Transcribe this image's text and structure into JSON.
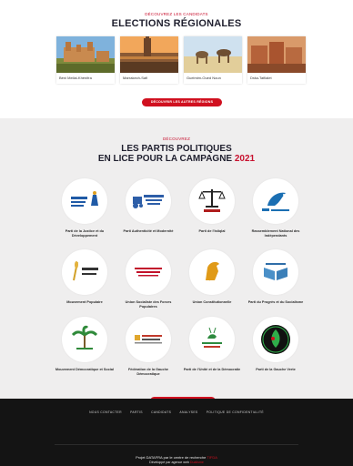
{
  "regions": {
    "eyebrow": "DÉCOUVREZ LES CANDIDATS",
    "title": "ELECTIONS RÉGIONALES",
    "cards": [
      {
        "name": "Béni Mellal-Khénifra"
      },
      {
        "name": "Marrakech-Safi"
      },
      {
        "name": "Guelmim-Oued Noun"
      },
      {
        "name": "Drâa-Tafilalet"
      }
    ],
    "button_label": "DÉCOUVRIR LES AUTRES RÉGIONS"
  },
  "parties": {
    "eyebrow": "DÉCOUVREZ",
    "title_line1": "LES PARTIS POLITIQUES",
    "title_line2": "EN LICE POUR LA CAMPAGNE",
    "year": "2021",
    "items": [
      {
        "name": "Parti de la Justice et du Développement",
        "icon": "lamp-logo-icon"
      },
      {
        "name": "Parti Authenticité et Modernité",
        "icon": "tractor-logo-icon"
      },
      {
        "name": "Parti de l'Istiqlal",
        "icon": "scales-logo-icon"
      },
      {
        "name": "Rassemblement National des Indépendants",
        "icon": "dove-logo-icon"
      },
      {
        "name": "Mouvement Populaire",
        "icon": "wheat-logo-icon"
      },
      {
        "name": "Union Socialiste des Forces Populaires",
        "icon": "rose-logo-icon"
      },
      {
        "name": "Union Constitutionnelle",
        "icon": "horse-logo-icon"
      },
      {
        "name": "Parti du Progrès et du Socialisme",
        "icon": "book-logo-icon"
      },
      {
        "name": "Mouvement Démocratique et Social",
        "icon": "palm-logo-icon"
      },
      {
        "name": "Fédération de la Gauche Démocratique",
        "icon": "fgd-logo-icon"
      },
      {
        "name": "Parti de l'Unité et de la Démocratie",
        "icon": "gazelle-logo-icon"
      },
      {
        "name": "Parti de la Gauche Verte",
        "icon": "green-left-logo-icon"
      }
    ],
    "button_label": "VOIR TOUS LES PARTIS"
  },
  "footer": {
    "nav": [
      "NOUS CONTACTER",
      "PARTIS",
      "CANDIDATS",
      "ANALYSES",
      "POLITIQUE DE CONFIDENTIALITÉ"
    ],
    "credit_prefix": "Projet DATAFRA par le centre de recherche",
    "credit_highlight": "TIFDA",
    "credit2_prefix": "Développé par agence web",
    "credit2_highlight": "Dualisme"
  },
  "colors": {
    "accent": "#d0101f",
    "section_bg": "#efeeee",
    "footer_bg": "#141414"
  }
}
